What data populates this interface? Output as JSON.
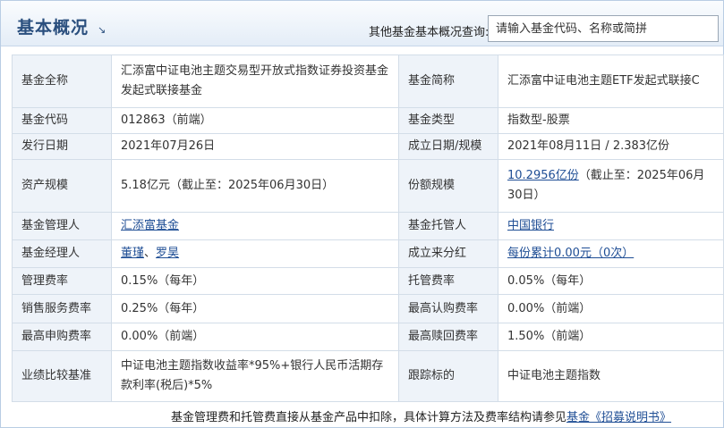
{
  "header": {
    "title": "基本概况",
    "title_arrow": "↘",
    "search_label": "其他基金基本概况查询:",
    "search_placeholder": "请输入基金代码、名称或简拼"
  },
  "rows": [
    {
      "l1": "基金全称",
      "v1": "汇添富中证电池主题交易型开放式指数证券投资基金发起式联接基金",
      "l2": "基金简称",
      "v2": "汇添富中证电池主题ETF发起式联接C"
    },
    {
      "l1": "基金代码",
      "v1": "012863（前端）",
      "l2": "基金类型",
      "v2": "指数型-股票"
    },
    {
      "l1": "发行日期",
      "v1": "2021年07月26日",
      "l2": "成立日期/规模",
      "v2": "2021年08月11日 / 2.383亿份"
    },
    {
      "l1": "资产规模",
      "v1": "5.18亿元（截止至：2025年06月30日）",
      "l2": "份额规模",
      "v2_link": "10.2956亿份",
      "v2": "（截止至：2025年06月30日）"
    },
    {
      "l1": "基金管理人",
      "v1_link": "汇添富基金",
      "l2": "基金托管人",
      "v2_link": "中国银行"
    },
    {
      "l1": "基金经理人",
      "v1_link": "董瑾",
      "v1_sep": "、",
      "v1_link2": "罗昊",
      "l2": "成立来分红",
      "v2_link": "每份累计0.00元（0次）"
    },
    {
      "l1": "管理费率",
      "v1": "0.15%（每年）",
      "l2": "托管费率",
      "v2": "0.05%（每年）"
    },
    {
      "l1": "销售服务费率",
      "v1": "0.25%（每年）",
      "l2": "最高认购费率",
      "v2": "0.00%（前端）"
    },
    {
      "l1": "最高申购费率",
      "v1": "0.00%（前端）",
      "l2": "最高赎回费率",
      "v2": "1.50%（前端）"
    },
    {
      "l1": "业绩比较基准",
      "v1": "中证电池主题指数收益率*95%+银行人民币活期存款利率(税后)*5%",
      "l2": "跟踪标的",
      "v2": "中证电池主题指数"
    }
  ],
  "footer": {
    "text": "基金管理费和托管费直接从基金产品中扣除，具体计算方法及费率结构请参见",
    "link": "基金《招募说明书》"
  }
}
